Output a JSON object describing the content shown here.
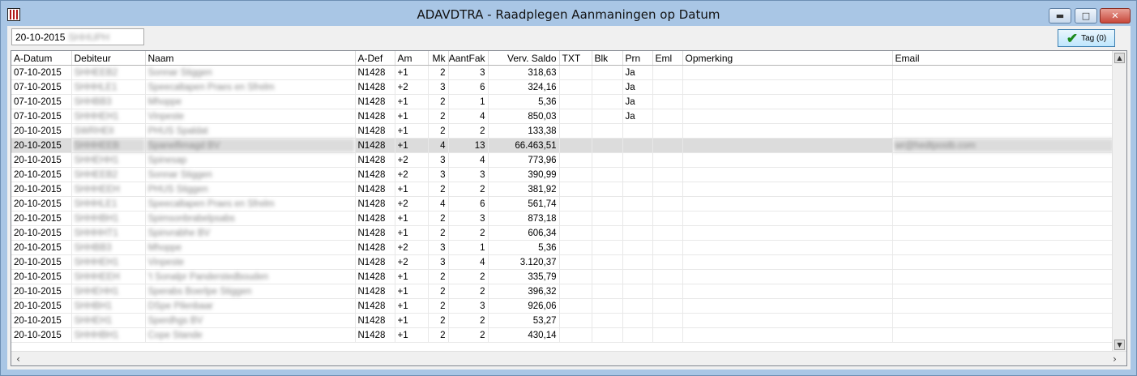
{
  "window": {
    "title": "ADAVDTRA - Raadplegen Aanmaningen op Datum"
  },
  "filter": {
    "date": "20-10-2015",
    "code": "SHHUPH"
  },
  "tag_button": {
    "label": "Tag (0)"
  },
  "columns": [
    "A-Datum",
    "Debiteur",
    "Naam",
    "A-Def",
    "Am",
    "Mk",
    "AantFak",
    "Verv. Saldo",
    "TXT",
    "Blk",
    "Prn",
    "Eml",
    "Opmerking",
    "Email"
  ],
  "rows": [
    {
      "adatum": "07-10-2015",
      "debiteur": "SHHEEB2",
      "naam": "Sonnar Stiggen",
      "adef": "N1428",
      "am": "+1",
      "mk": "2",
      "aantfak": "3",
      "saldo": "318,63",
      "txt": "",
      "blk": "",
      "prn": "Ja",
      "eml": "",
      "opm": "",
      "email": ""
    },
    {
      "adatum": "07-10-2015",
      "debiteur": "SHHHLE1",
      "naam": "Speecaltapen Praes en Sfrelm",
      "adef": "N1428",
      "am": "+2",
      "mk": "3",
      "aantfak": "6",
      "saldo": "324,16",
      "txt": "",
      "blk": "",
      "prn": "Ja",
      "eml": "",
      "opm": "",
      "email": ""
    },
    {
      "adatum": "07-10-2015",
      "debiteur": "SHHBB3",
      "naam": "Mhoppe",
      "adef": "N1428",
      "am": "+1",
      "mk": "2",
      "aantfak": "1",
      "saldo": "5,36",
      "txt": "",
      "blk": "",
      "prn": "Ja",
      "eml": "",
      "opm": "",
      "email": ""
    },
    {
      "adatum": "07-10-2015",
      "debiteur": "SHHHEH1",
      "naam": "Vinpeste",
      "adef": "N1428",
      "am": "+1",
      "mk": "2",
      "aantfak": "4",
      "saldo": "850,03",
      "txt": "",
      "blk": "",
      "prn": "Ja",
      "eml": "",
      "opm": "",
      "email": ""
    },
    {
      "adatum": "20-10-2015",
      "debiteur": "SWRHEII",
      "naam": "PHUS Spaldat",
      "adef": "N1428",
      "am": "+1",
      "mk": "2",
      "aantfak": "2",
      "saldo": "133,38",
      "txt": "",
      "blk": "",
      "prn": "",
      "eml": "",
      "opm": "",
      "email": ""
    },
    {
      "adatum": "20-10-2015",
      "debiteur": "SHHHEEB",
      "naam": "Spanelfimagd BV",
      "adef": "N1428",
      "am": "+1",
      "mk": "4",
      "aantfak": "13",
      "saldo": "66.463,51",
      "txt": "",
      "blk": "",
      "prn": "",
      "eml": "",
      "opm": "",
      "email": "wr@hedtpostb.com"
    },
    {
      "adatum": "20-10-2015",
      "debiteur": "SHHEHH1",
      "naam": "Spinesap",
      "adef": "N1428",
      "am": "+2",
      "mk": "3",
      "aantfak": "4",
      "saldo": "773,96",
      "txt": "",
      "blk": "",
      "prn": "",
      "eml": "",
      "opm": "",
      "email": ""
    },
    {
      "adatum": "20-10-2015",
      "debiteur": "SHHEEB2",
      "naam": "Sonnar Stiggen",
      "adef": "N1428",
      "am": "+2",
      "mk": "3",
      "aantfak": "3",
      "saldo": "390,99",
      "txt": "",
      "blk": "",
      "prn": "",
      "eml": "",
      "opm": "",
      "email": ""
    },
    {
      "adatum": "20-10-2015",
      "debiteur": "SHHHEEH",
      "naam": "PHUS Stiggen",
      "adef": "N1428",
      "am": "+1",
      "mk": "2",
      "aantfak": "2",
      "saldo": "381,92",
      "txt": "",
      "blk": "",
      "prn": "",
      "eml": "",
      "opm": "",
      "email": ""
    },
    {
      "adatum": "20-10-2015",
      "debiteur": "SHHHLE1",
      "naam": "Speecaltapen Praes en Sfrelm",
      "adef": "N1428",
      "am": "+2",
      "mk": "4",
      "aantfak": "6",
      "saldo": "561,74",
      "txt": "",
      "blk": "",
      "prn": "",
      "eml": "",
      "opm": "",
      "email": ""
    },
    {
      "adatum": "20-10-2015",
      "debiteur": "SHHHBH1",
      "naam": "Spimsonbrabelpsabs",
      "adef": "N1428",
      "am": "+1",
      "mk": "2",
      "aantfak": "3",
      "saldo": "873,18",
      "txt": "",
      "blk": "",
      "prn": "",
      "eml": "",
      "opm": "",
      "email": ""
    },
    {
      "adatum": "20-10-2015",
      "debiteur": "SHHHHT1",
      "naam": "Spinvrabhe BV",
      "adef": "N1428",
      "am": "+1",
      "mk": "2",
      "aantfak": "2",
      "saldo": "606,34",
      "txt": "",
      "blk": "",
      "prn": "",
      "eml": "",
      "opm": "",
      "email": ""
    },
    {
      "adatum": "20-10-2015",
      "debiteur": "SHHBB3",
      "naam": "Mhoppe",
      "adef": "N1428",
      "am": "+2",
      "mk": "3",
      "aantfak": "1",
      "saldo": "5,36",
      "txt": "",
      "blk": "",
      "prn": "",
      "eml": "",
      "opm": "",
      "email": ""
    },
    {
      "adatum": "20-10-2015",
      "debiteur": "SHHHEH1",
      "naam": "Vinpeste",
      "adef": "N1428",
      "am": "+2",
      "mk": "3",
      "aantfak": "4",
      "saldo": "3.120,37",
      "txt": "",
      "blk": "",
      "prn": "",
      "eml": "",
      "opm": "",
      "email": ""
    },
    {
      "adatum": "20-10-2015",
      "debiteur": "SHHHEEH",
      "naam": "'t Sonalpr Panderstedbouden",
      "adef": "N1428",
      "am": "+1",
      "mk": "2",
      "aantfak": "2",
      "saldo": "335,79",
      "txt": "",
      "blk": "",
      "prn": "",
      "eml": "",
      "opm": "",
      "email": ""
    },
    {
      "adatum": "20-10-2015",
      "debiteur": "SHHEHH1",
      "naam": "Sperabs Boerlpe Stiggen",
      "adef": "N1428",
      "am": "+1",
      "mk": "2",
      "aantfak": "2",
      "saldo": "396,32",
      "txt": "",
      "blk": "",
      "prn": "",
      "eml": "",
      "opm": "",
      "email": ""
    },
    {
      "adatum": "20-10-2015",
      "debiteur": "SHHBH1",
      "naam": "DSpe Pilenbaar",
      "adef": "N1428",
      "am": "+1",
      "mk": "2",
      "aantfak": "3",
      "saldo": "926,06",
      "txt": "",
      "blk": "",
      "prn": "",
      "eml": "",
      "opm": "",
      "email": ""
    },
    {
      "adatum": "20-10-2015",
      "debiteur": "SHHEH1",
      "naam": "Sperdhgs BV",
      "adef": "N1428",
      "am": "+1",
      "mk": "2",
      "aantfak": "2",
      "saldo": "53,27",
      "txt": "",
      "blk": "",
      "prn": "",
      "eml": "",
      "opm": "",
      "email": ""
    },
    {
      "adatum": "20-10-2015",
      "debiteur": "SHHHBH1",
      "naam": "Cope Stande",
      "adef": "N1428",
      "am": "+1",
      "mk": "2",
      "aantfak": "2",
      "saldo": "430,14",
      "txt": "",
      "blk": "",
      "prn": "",
      "eml": "",
      "opm": "",
      "email": ""
    }
  ],
  "selected_row": 5
}
